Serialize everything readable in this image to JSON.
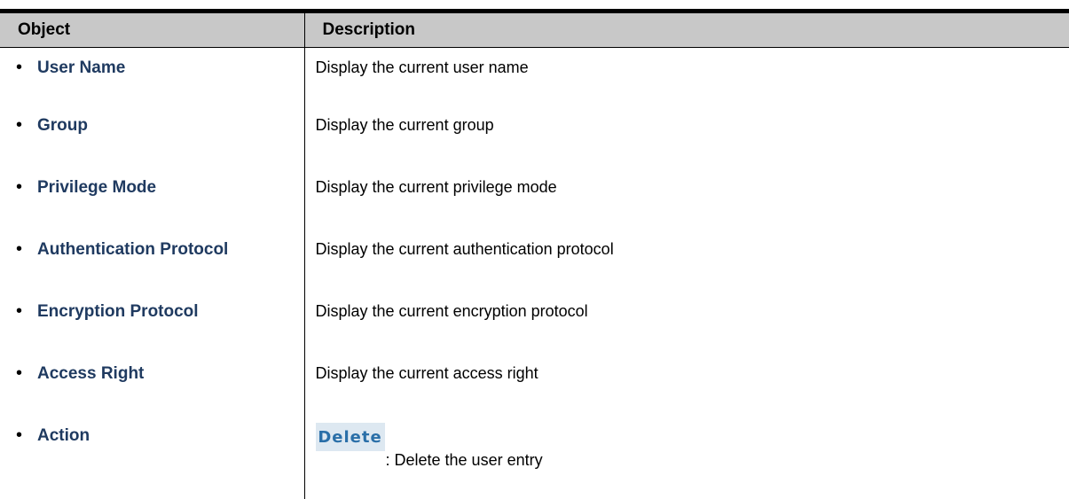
{
  "table": {
    "headers": {
      "object": "Object",
      "description": "Description"
    },
    "rows": [
      {
        "object": "User Name",
        "description": "Display the current user name"
      },
      {
        "object": "Group",
        "description": "Display the current group"
      },
      {
        "object": "Privilege Mode",
        "description": "Display the current privilege mode"
      },
      {
        "object": "Authentication Protocol",
        "description": "Display the current authentication protocol"
      },
      {
        "object": "Encryption Protocol",
        "description": "Display the current encryption protocol"
      },
      {
        "object": "Access Right",
        "description": "Display the current access right"
      },
      {
        "object": "Action",
        "button": "Delete",
        "description": ": Delete the user entry"
      }
    ]
  },
  "colors": {
    "header_bg": "#c8c8c8",
    "object_label": "#1f3a60",
    "button_bg": "#dde8f1",
    "button_text": "#2a6fa8"
  }
}
